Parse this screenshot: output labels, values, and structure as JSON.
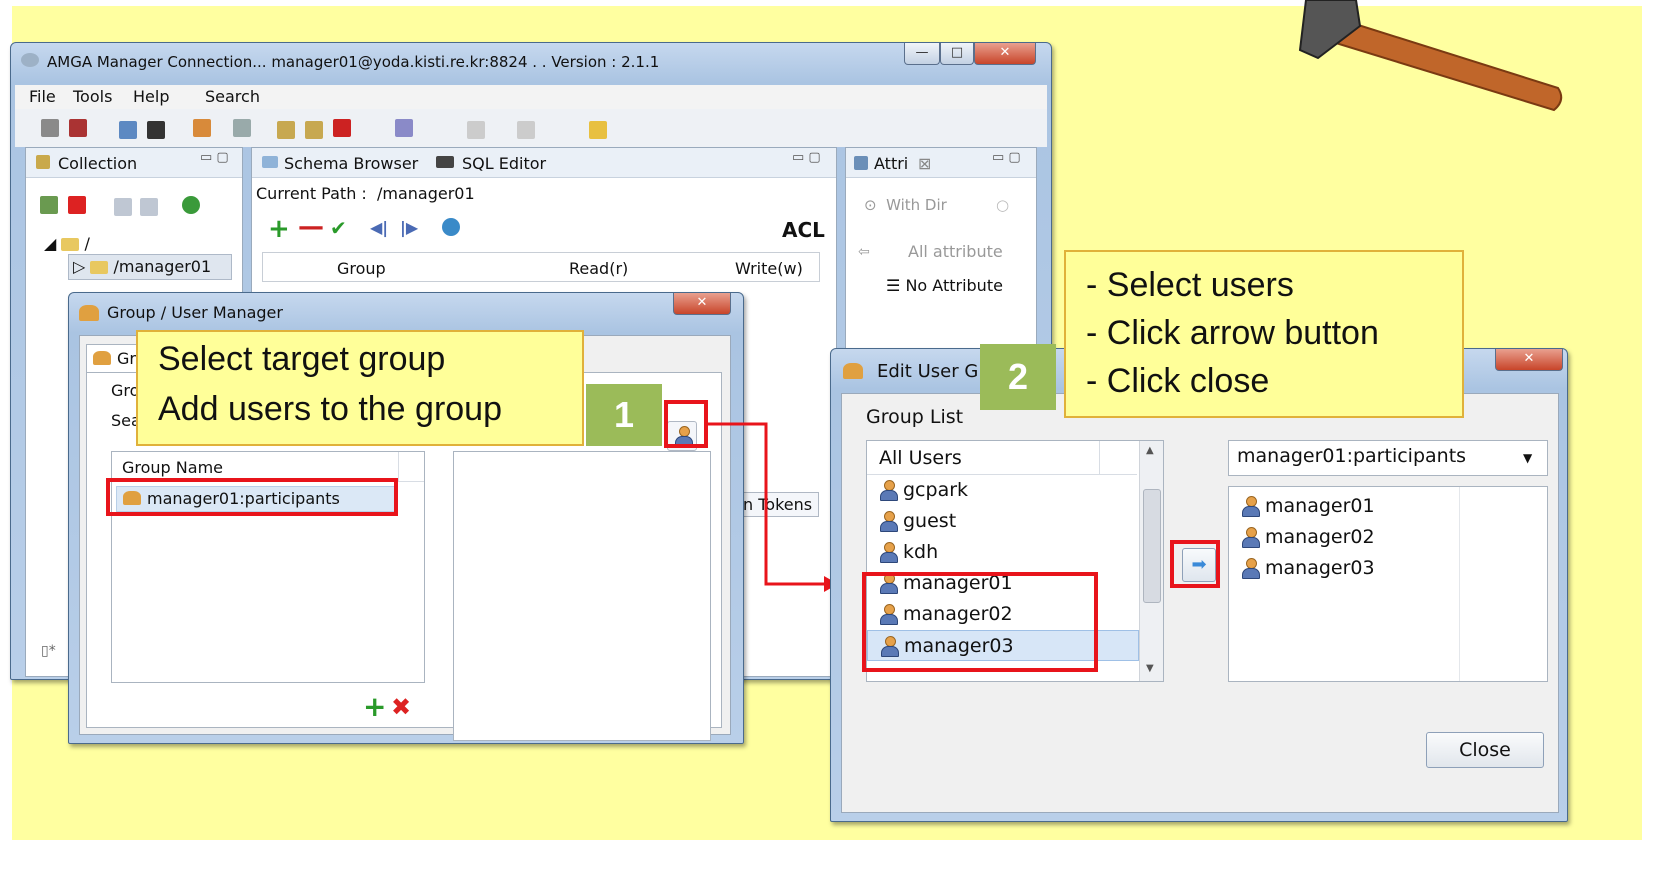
{
  "main_window": {
    "title": "AMGA Manager Connection... manager01@yoda.kisti.re.kr:8824 . . Version : 2.1.1",
    "menu": [
      "File",
      "Tools",
      "Help",
      "Search"
    ],
    "collection_tab": "Collection",
    "tree_root": "/",
    "tree_child": "/manager01",
    "tabs": [
      "Schema Browser",
      "SQL Editor"
    ],
    "current_path_label": "Current Path :",
    "current_path_value": "/manager01",
    "acl_label": "ACL",
    "columns": [
      "Group",
      "Read(r)",
      "Write(w)"
    ],
    "attri_tab": "Attri",
    "with_dir": "With Dir",
    "all_attribute": "All attribute",
    "no_attribute": "No Attribute",
    "tokens_tab": "n Tokens"
  },
  "group_manager": {
    "title": "Group / User Manager",
    "tab_label": "Gr",
    "group_label": "Gro",
    "search_label": "Sea",
    "column_header": "Group Name",
    "group_item": "manager01:participants"
  },
  "edit_user": {
    "title": "Edit User G",
    "group_list_label": "Group List",
    "list_header": "All Users",
    "users": [
      "gcpark",
      "guest",
      "kdh",
      "manager01",
      "manager02",
      "manager03"
    ],
    "selected_group": "manager01:participants",
    "members": [
      "manager01",
      "manager02",
      "manager03"
    ],
    "close_button": "Close"
  },
  "callouts": {
    "step1": {
      "number": "1",
      "lines": [
        "Select target group",
        "Add users to the group"
      ]
    },
    "step2": {
      "number": "2",
      "lines": [
        "- Select users",
        "- Click arrow button",
        "- Click close"
      ]
    }
  },
  "colors": {
    "slide": "#ffffa0",
    "highlight": "#e8141b",
    "step_badge": "#9bbb59",
    "callout": "#ffff99"
  }
}
